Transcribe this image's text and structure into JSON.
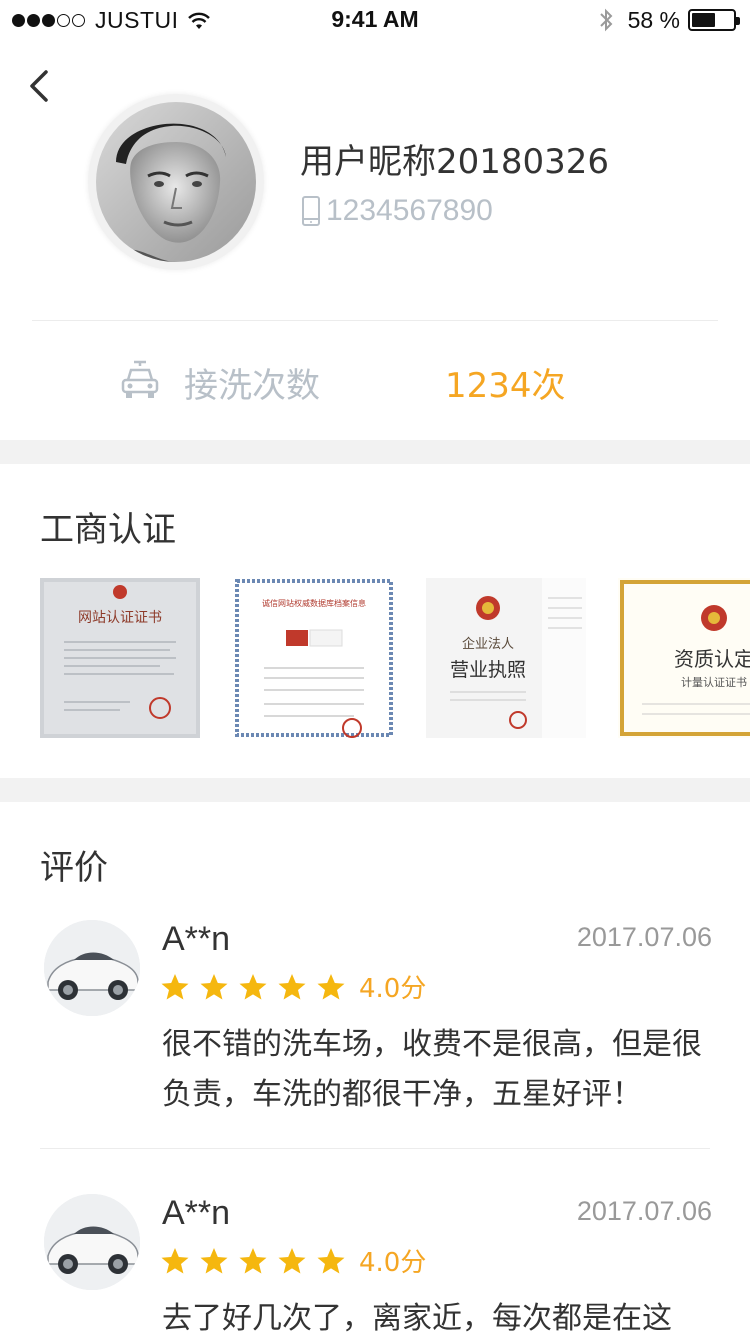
{
  "status_bar": {
    "carrier": "JUSTUI",
    "time": "9:41 AM",
    "battery": "58 %",
    "battery_level": 0.58
  },
  "profile": {
    "nickname": "用户昵称20180326",
    "phone": "1234567890"
  },
  "wash": {
    "label": "接洗次数",
    "count": "1234次"
  },
  "certification": {
    "title": "工商认证",
    "images": [
      {
        "title": "网站认证证书"
      },
      {
        "title": "诚信网站权威数据库档案信息"
      },
      {
        "title": "企业法人",
        "subtitle": "营业执照"
      },
      {
        "title": "资质认定",
        "subtitle": "计量认证证书"
      }
    ]
  },
  "reviews": {
    "title": "评价",
    "items": [
      {
        "name": "A**n",
        "date": "2017.07.06",
        "rating": 5,
        "score": "4.0分",
        "text": "很不错的洗车场，收费不是很高，但是很负责，车洗的都很干净，五星好评！"
      },
      {
        "name": "A**n",
        "date": "2017.07.06",
        "rating": 5,
        "score": "4.0分",
        "text": "去了好几次了，离家近，每次都是在这"
      }
    ]
  },
  "colors": {
    "accent": "#f5a623",
    "muted": "#b8c0c8",
    "divider": "#ececec",
    "section_gap": "#f2f2f2"
  }
}
